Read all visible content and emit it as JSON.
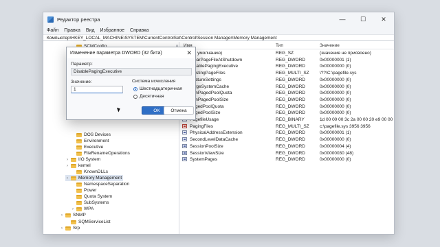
{
  "window": {
    "title": "Редактор реестра",
    "controls": {
      "minimize": "—",
      "maximize": "☐",
      "close": "✕"
    }
  },
  "menu": [
    "Файл",
    "Правка",
    "Вид",
    "Избранное",
    "Справка"
  ],
  "address": "Компьютер\\HKEY_LOCAL_MACHINE\\SYSTEM\\CurrentControlSet\\Control\\Session Manager\\Memory Management",
  "tree": [
    {
      "label": "SCMConfig",
      "expander": ""
    },
    {
      "label": "DOS Devices",
      "expander": ""
    },
    {
      "label": "Environment",
      "expander": ""
    },
    {
      "label": "Executive",
      "expander": ""
    },
    {
      "label": "FileRenameOperations",
      "expander": ""
    },
    {
      "label": "I/O System",
      "expander": "›"
    },
    {
      "label": "kernel",
      "expander": "›"
    },
    {
      "label": "KnownDLLs",
      "expander": ""
    },
    {
      "label": "Memory Management",
      "expander": "›",
      "selected": true
    },
    {
      "label": "NamespaceSeparation",
      "expander": ""
    },
    {
      "label": "Power",
      "expander": ""
    },
    {
      "label": "Quota System",
      "expander": ""
    },
    {
      "label": "SubSystems",
      "expander": ""
    },
    {
      "label": "WPA",
      "expander": "›"
    },
    {
      "label": "SNMP",
      "expander": "›"
    },
    {
      "label": "SQMServiceList",
      "expander": ""
    },
    {
      "label": "Srp",
      "expander": "›"
    }
  ],
  "columns": {
    "name": "Имя",
    "type": "Тип",
    "data": "Значение"
  },
  "values": [
    {
      "name": "(по умолчанию)",
      "type": "REG_SZ",
      "data": "(значение не присвоено)",
      "kind": "sz"
    },
    {
      "name": "ClearPageFileAtShutdown",
      "type": "REG_DWORD",
      "data": "0x00000001 (1)",
      "kind": "dw"
    },
    {
      "name": "DisablePagingExecutive",
      "type": "REG_DWORD",
      "data": "0x00000000 (0)",
      "kind": "dw"
    },
    {
      "name": "ExistingPageFiles",
      "type": "REG_MULTI_SZ",
      "data": "\\??\\C:\\pagefile.sys",
      "kind": "sz"
    },
    {
      "name": "FeatureSettings",
      "type": "REG_DWORD",
      "data": "0x00000000 (0)",
      "kind": "dw"
    },
    {
      "name": "LargeSystemCache",
      "type": "REG_DWORD",
      "data": "0x00000000 (0)",
      "kind": "dw"
    },
    {
      "name": "NonPagedPoolQuota",
      "type": "REG_DWORD",
      "data": "0x00000000 (0)",
      "kind": "dw"
    },
    {
      "name": "NonPagedPoolSize",
      "type": "REG_DWORD",
      "data": "0x00000000 (0)",
      "kind": "dw"
    },
    {
      "name": "PagedPoolQuota",
      "type": "REG_DWORD",
      "data": "0x00000000 (0)",
      "kind": "dw"
    },
    {
      "name": "PagedPoolSize",
      "type": "REG_DWORD",
      "data": "0x00000000 (0)",
      "kind": "dw"
    },
    {
      "name": "PagefileUsage",
      "type": "REG_BINARY",
      "data": "1d 00 00 00 3c 2a 00 00 20 e9 00 00 5",
      "kind": "dw"
    },
    {
      "name": "PagingFiles",
      "type": "REG_MULTI_SZ",
      "data": "c:\\pagefile.sys 3956 3956",
      "kind": "sz"
    },
    {
      "name": "PhysicalAddressExtension",
      "type": "REG_DWORD",
      "data": "0x00000001 (1)",
      "kind": "dw"
    },
    {
      "name": "SecondLevelDataCache",
      "type": "REG_DWORD",
      "data": "0x00000000 (0)",
      "kind": "dw"
    },
    {
      "name": "SessionPoolSize",
      "type": "REG_DWORD",
      "data": "0x00000004 (4)",
      "kind": "dw"
    },
    {
      "name": "SessionViewSize",
      "type": "REG_DWORD",
      "data": "0x00000030 (48)",
      "kind": "dw"
    },
    {
      "name": "SystemPages",
      "type": "REG_DWORD",
      "data": "0x00000000 (0)",
      "kind": "dw"
    }
  ],
  "dialog": {
    "title": "Изменение параметра DWORD (32 бита)",
    "close": "✕",
    "param_label": "Параметр:",
    "param_value": "DisablePagingExecutive",
    "value_label": "Значение:",
    "value_input": "1",
    "base_label": "Система исчисления",
    "radio_hex": "Шестнадцатеричная",
    "radio_dec": "Десятичная",
    "hex_checked": true,
    "ok": "OK",
    "cancel": "Отмена"
  }
}
